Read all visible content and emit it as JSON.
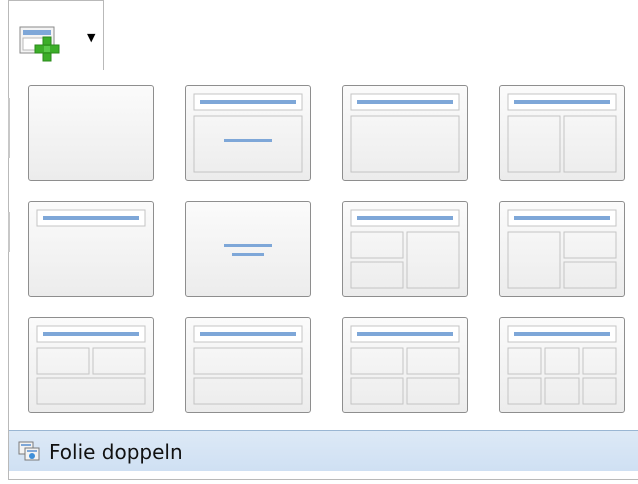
{
  "top_button": {
    "icon": "new-slide-icon",
    "dropdown_icon": "dropdown-arrow-icon"
  },
  "layouts": [
    {
      "id": "blank"
    },
    {
      "id": "title-slide"
    },
    {
      "id": "title-content"
    },
    {
      "id": "title-2-content"
    },
    {
      "id": "title-only"
    },
    {
      "id": "centered-text"
    },
    {
      "id": "title-2-content-left-2"
    },
    {
      "id": "title-2-content-right-2"
    },
    {
      "id": "title-2-over-1"
    },
    {
      "id": "title-content-over-content"
    },
    {
      "id": "title-4-content"
    },
    {
      "id": "title-6-content"
    }
  ],
  "footer": {
    "icon": "duplicate-slide-icon",
    "label": "Folie doppeln"
  },
  "colors": {
    "title_bar": "#7ea7d8",
    "accent_bg": "#d4e4f5",
    "icon_green": "#3cae29"
  }
}
